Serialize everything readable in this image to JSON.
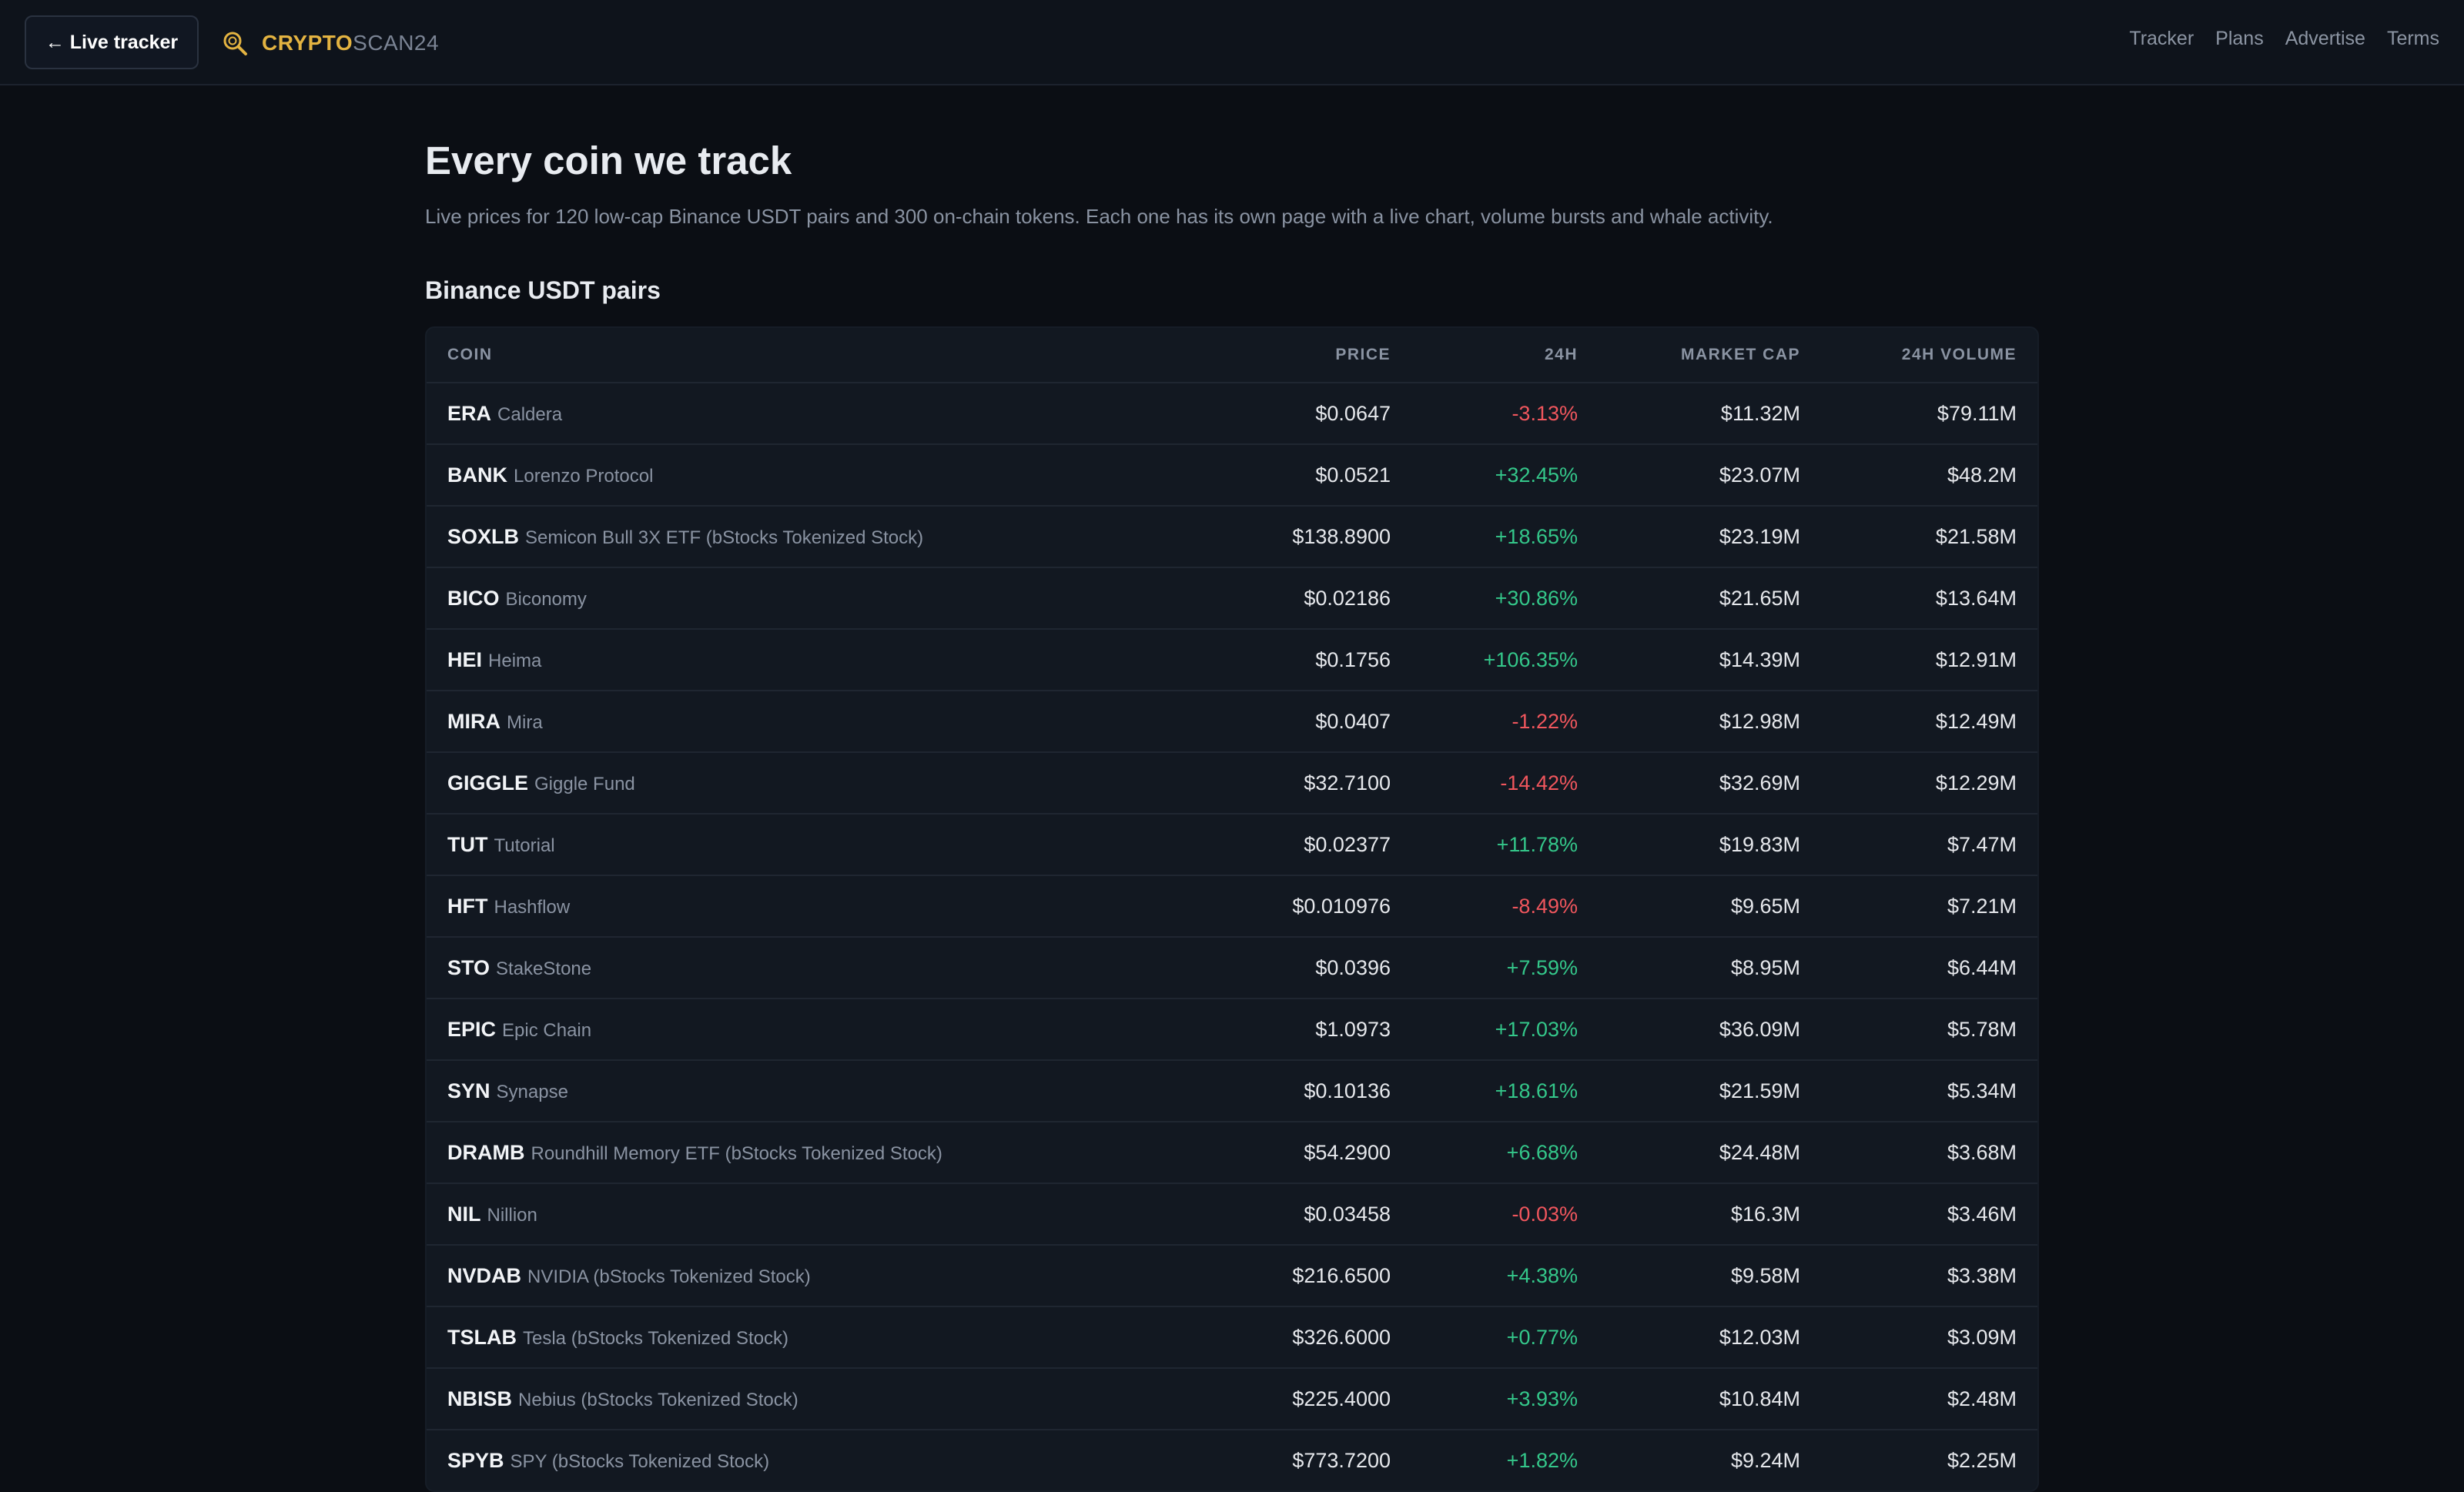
{
  "header": {
    "back_label": "← Live tracker",
    "brand_strong": "CRYPTO",
    "brand_light": "SCAN24",
    "brand_icon": "magnifier-coin-icon",
    "accent_color": "#e3b341",
    "nav": [
      "Tracker",
      "Plans",
      "Advertise",
      "Terms"
    ]
  },
  "page": {
    "title": "Every coin we track",
    "description": "Live prices for 120 low-cap Binance USDT pairs and 300 on-chain tokens. Each one has its own page with a live chart, volume bursts and whale activity.",
    "section_title": "Binance USDT pairs"
  },
  "table": {
    "columns": [
      "COIN",
      "PRICE",
      "24H",
      "MARKET CAP",
      "24H VOLUME"
    ],
    "up_color": "#34c78a",
    "down_color": "#f0565d",
    "rows": [
      {
        "symbol": "ERA",
        "name": "Caldera",
        "price": "$0.0647",
        "change": "-3.13%",
        "direction": "down",
        "market_cap": "$11.32M",
        "volume": "$79.11M"
      },
      {
        "symbol": "BANK",
        "name": "Lorenzo Protocol",
        "price": "$0.0521",
        "change": "+32.45%",
        "direction": "up",
        "market_cap": "$23.07M",
        "volume": "$48.2M"
      },
      {
        "symbol": "SOXLB",
        "name": "Semicon Bull 3X ETF (bStocks Tokenized Stock)",
        "price": "$138.8900",
        "change": "+18.65%",
        "direction": "up",
        "market_cap": "$23.19M",
        "volume": "$21.58M"
      },
      {
        "symbol": "BICO",
        "name": "Biconomy",
        "price": "$0.02186",
        "change": "+30.86%",
        "direction": "up",
        "market_cap": "$21.65M",
        "volume": "$13.64M"
      },
      {
        "symbol": "HEI",
        "name": "Heima",
        "price": "$0.1756",
        "change": "+106.35%",
        "direction": "up",
        "market_cap": "$14.39M",
        "volume": "$12.91M"
      },
      {
        "symbol": "MIRA",
        "name": "Mira",
        "price": "$0.0407",
        "change": "-1.22%",
        "direction": "down",
        "market_cap": "$12.98M",
        "volume": "$12.49M"
      },
      {
        "symbol": "GIGGLE",
        "name": "Giggle Fund",
        "price": "$32.7100",
        "change": "-14.42%",
        "direction": "down",
        "market_cap": "$32.69M",
        "volume": "$12.29M"
      },
      {
        "symbol": "TUT",
        "name": "Tutorial",
        "price": "$0.02377",
        "change": "+11.78%",
        "direction": "up",
        "market_cap": "$19.83M",
        "volume": "$7.47M"
      },
      {
        "symbol": "HFT",
        "name": "Hashflow",
        "price": "$0.010976",
        "change": "-8.49%",
        "direction": "down",
        "market_cap": "$9.65M",
        "volume": "$7.21M"
      },
      {
        "symbol": "STO",
        "name": "StakeStone",
        "price": "$0.0396",
        "change": "+7.59%",
        "direction": "up",
        "market_cap": "$8.95M",
        "volume": "$6.44M"
      },
      {
        "symbol": "EPIC",
        "name": "Epic Chain",
        "price": "$1.0973",
        "change": "+17.03%",
        "direction": "up",
        "market_cap": "$36.09M",
        "volume": "$5.78M"
      },
      {
        "symbol": "SYN",
        "name": "Synapse",
        "price": "$0.10136",
        "change": "+18.61%",
        "direction": "up",
        "market_cap": "$21.59M",
        "volume": "$5.34M"
      },
      {
        "symbol": "DRAMB",
        "name": "Roundhill Memory ETF (bStocks Tokenized Stock)",
        "price": "$54.2900",
        "change": "+6.68%",
        "direction": "up",
        "market_cap": "$24.48M",
        "volume": "$3.68M"
      },
      {
        "symbol": "NIL",
        "name": "Nillion",
        "price": "$0.03458",
        "change": "-0.03%",
        "direction": "down",
        "market_cap": "$16.3M",
        "volume": "$3.46M"
      },
      {
        "symbol": "NVDAB",
        "name": "NVIDIA (bStocks Tokenized Stock)",
        "price": "$216.6500",
        "change": "+4.38%",
        "direction": "up",
        "market_cap": "$9.58M",
        "volume": "$3.38M"
      },
      {
        "symbol": "TSLAB",
        "name": "Tesla (bStocks Tokenized Stock)",
        "price": "$326.6000",
        "change": "+0.77%",
        "direction": "up",
        "market_cap": "$12.03M",
        "volume": "$3.09M"
      },
      {
        "symbol": "NBISB",
        "name": "Nebius (bStocks Tokenized Stock)",
        "price": "$225.4000",
        "change": "+3.93%",
        "direction": "up",
        "market_cap": "$10.84M",
        "volume": "$2.48M"
      },
      {
        "symbol": "SPYB",
        "name": "SPY (bStocks Tokenized Stock)",
        "price": "$773.7200",
        "change": "+1.82%",
        "direction": "up",
        "market_cap": "$9.24M",
        "volume": "$2.25M"
      }
    ]
  }
}
